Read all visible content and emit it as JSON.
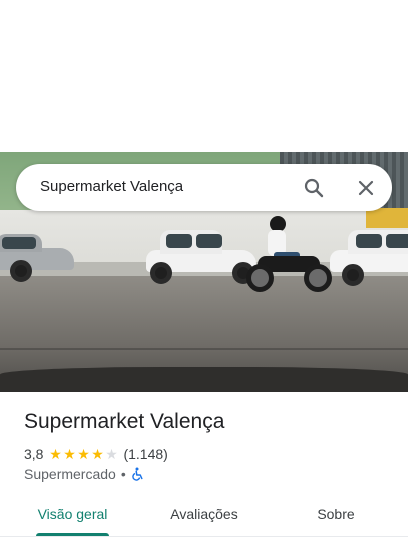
{
  "search": {
    "query": "Supermarket Valença"
  },
  "place": {
    "name": "Supermarket Valença",
    "rating": "3,8",
    "stars_filled": 4,
    "stars_total": 5,
    "reviews": "(1.148)",
    "category": "Supermercado",
    "separator": "•",
    "accessibility_icon": "wheelchair-icon"
  },
  "tabs": [
    {
      "label": "Visão geral",
      "active": true
    },
    {
      "label": "Avaliações",
      "active": false
    },
    {
      "label": "Sobre",
      "active": false
    }
  ],
  "colors": {
    "accent": "#12806f",
    "star": "#fbbc04",
    "wheelchair": "#1a73e8"
  },
  "icons": {
    "search": "search-icon",
    "close": "close-icon"
  }
}
